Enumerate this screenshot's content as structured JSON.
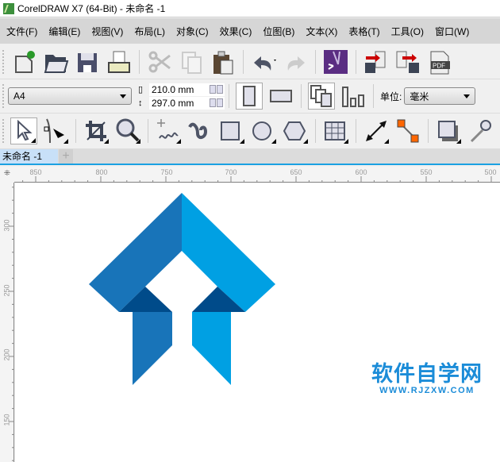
{
  "window": {
    "title": "CorelDRAW X7 (64-Bit) - 未命名 -1"
  },
  "menu": [
    "文件(F)",
    "编辑(E)",
    "视图(V)",
    "布局(L)",
    "对象(C)",
    "效果(C)",
    "位图(B)",
    "文本(X)",
    "表格(T)",
    "工具(O)",
    "窗口(W)"
  ],
  "property_bar": {
    "paper_size": "A4",
    "width": "210.0 mm",
    "height": "297.0 mm",
    "unit_label": "单位:",
    "unit_value": "毫米"
  },
  "document_tab": {
    "label": "未命名 -1"
  },
  "rulers": {
    "horizontal": [
      "850",
      "800",
      "750",
      "700",
      "650",
      "600",
      "550",
      "500"
    ],
    "vertical": [
      "300",
      "250",
      "200",
      "150"
    ]
  },
  "logo_colors": {
    "mid_blue": "#1874b9",
    "light_blue": "#00a0e3",
    "dark_blue": "#004b8a"
  },
  "watermark": {
    "title": "软件自学网",
    "url": "WWW.RJZXW.COM",
    "color": "#1b8cd8"
  }
}
